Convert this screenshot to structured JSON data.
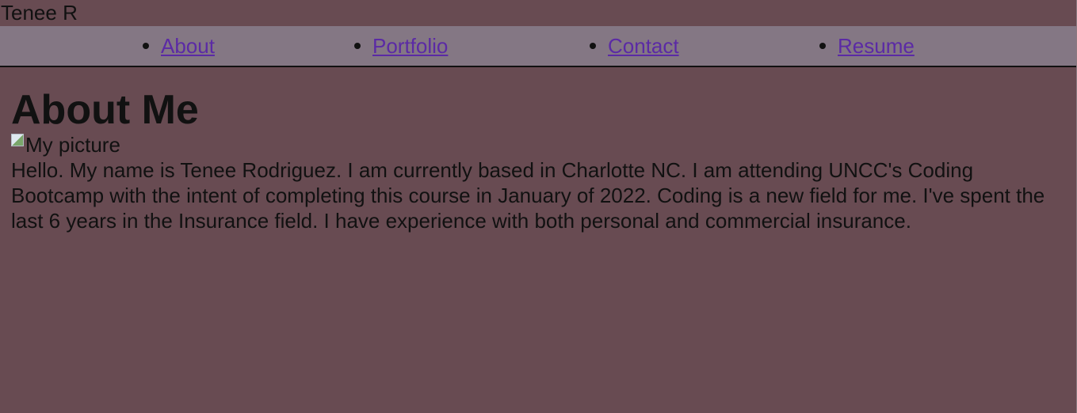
{
  "header": {
    "site_name": "Tenee R"
  },
  "nav": {
    "items": [
      {
        "label": "About"
      },
      {
        "label": "Portfolio"
      },
      {
        "label": "Contact"
      },
      {
        "label": "Resume"
      }
    ]
  },
  "main": {
    "title": "About Me",
    "image_alt": "My picture",
    "paragraph": "Hello. My name is Tenee Rodriguez. I am currently based in Charlotte NC. I am attending UNCC's Coding Bootcamp with the intent of completing this course in January of 2022. Coding is a new field for me. I've spent the last 6 years in the Insurance field. I have experience with both personal and commercial insurance."
  },
  "colors": {
    "page_background": "#684b52",
    "nav_background": "#847784",
    "link": "#5b2aa5",
    "text": "#111111"
  },
  "icons": {
    "broken_image": "broken-image-icon"
  }
}
